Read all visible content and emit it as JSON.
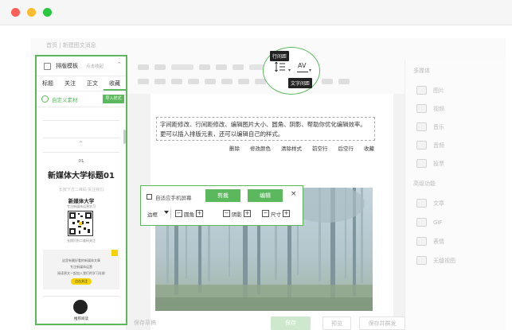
{
  "window": {
    "controls": [
      "close",
      "minimize",
      "maximize"
    ]
  },
  "backdrop": {
    "breadcrumb": "首页 | 新建图文消息",
    "right_panel": {
      "section1": "多媒体",
      "items1": [
        {
          "label": "图片",
          "icon": "image-icon"
        },
        {
          "label": "视频",
          "icon": "video-icon"
        },
        {
          "label": "音乐",
          "icon": "music-icon"
        },
        {
          "label": "音频",
          "icon": "audio-icon"
        },
        {
          "label": "投票",
          "icon": "vote-icon"
        }
      ],
      "section2": "高级功能",
      "items2": [
        {
          "label": "文章",
          "icon": "article-icon"
        },
        {
          "label": "GIF",
          "icon": "gif-icon"
        },
        {
          "label": "表情",
          "icon": "emoji-icon"
        },
        {
          "label": "无缝视图",
          "icon": "seamless-icon"
        }
      ]
    },
    "bottom_bar": {
      "left": "保存草稿",
      "save": "保存",
      "preview": "预览",
      "save_open": "保存并群发"
    }
  },
  "left_panel": {
    "title": "排版模板",
    "collapse_label": "点击收起",
    "tabs": [
      {
        "label": "标题",
        "active": false
      },
      {
        "label": "关注",
        "active": false
      },
      {
        "label": "正文",
        "active": false
      },
      {
        "label": "收藏",
        "active": true
      }
    ],
    "custom_material": "自定义素材",
    "import_button": "导入样式",
    "template_number": "01",
    "template_headline": "新媒体大学标题01",
    "follow_hint": "长按下方二维码 关注我们",
    "brand_name": "新媒体大学",
    "brand_sub": "专注新媒体运营学习",
    "qr_sub": "长按识别二维码关注",
    "card_lines": [
      "这里有最好看的新媒体文章",
      "专注新媒体运营",
      "阅读原文一起加入我们的学习社群"
    ],
    "card_button": "点击关注",
    "avatar_label": "推荐阅读"
  },
  "text_block": {
    "content": "字间距修改、行间距修改、编辑图片大小、圆角、阴影、帮助你优化编辑效率。更可以插入排版元素，还可以编辑自己的样式。",
    "ops": [
      "删除",
      "修改颜色",
      "清除样式",
      "前空行",
      "后空行",
      "收藏"
    ]
  },
  "phone_widget": {
    "label": "自适应手机屏幕",
    "crop": "剪裁",
    "edit": "编辑",
    "border": "边框",
    "controls": [
      "圆角",
      "阴影",
      "尺寸"
    ]
  },
  "magnifier": {
    "letter_icon": "AV",
    "tip_linespace": "行间距",
    "tip_letterspace": "文字间距"
  },
  "colors": {
    "accent": "#5bb85d",
    "yellow": "#f5d200"
  }
}
